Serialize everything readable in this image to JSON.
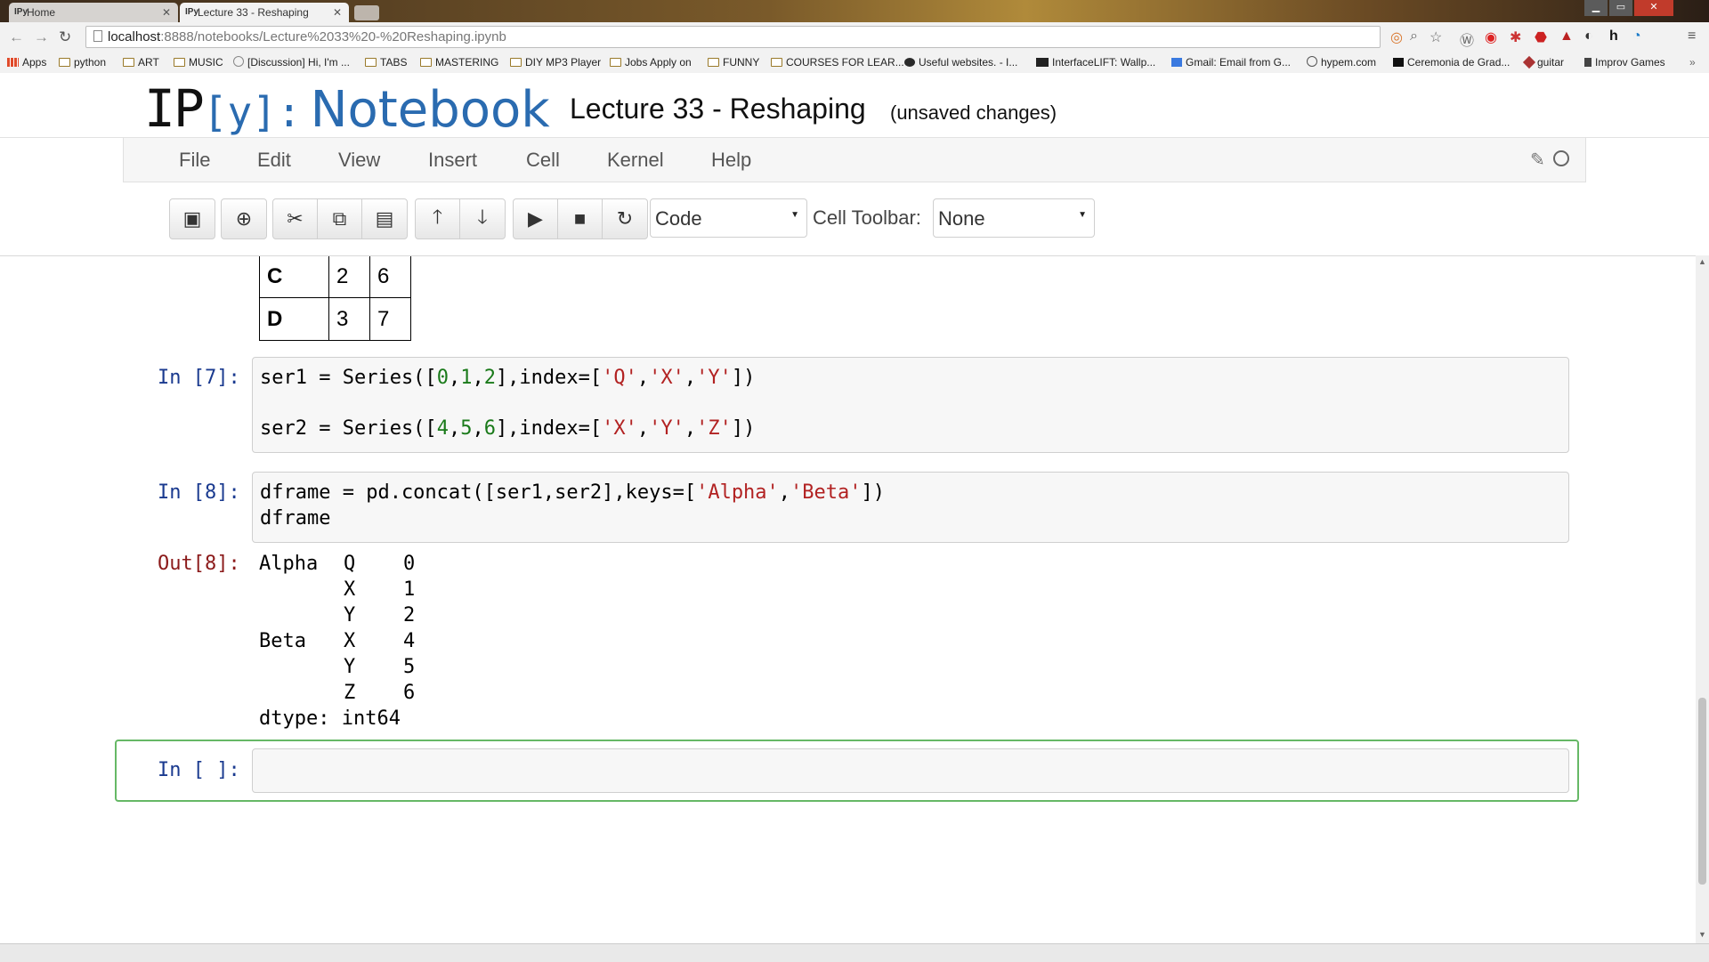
{
  "browser": {
    "tabs": [
      {
        "favicon": "IPy",
        "title": "Home"
      },
      {
        "favicon": "IPy",
        "title": "Lecture 33 - Reshaping"
      }
    ],
    "url_host": "localhost",
    "url_rest": ":8888/notebooks/Lecture%2033%20-%20Reshaping.ipynb",
    "bookmarks": [
      {
        "label": "Apps",
        "icon": "apps-grid-icon"
      },
      {
        "label": "python",
        "icon": "folder-icon"
      },
      {
        "label": "ART",
        "icon": "folder-icon"
      },
      {
        "label": "MUSIC",
        "icon": "folder-icon"
      },
      {
        "label": "[Discussion] Hi, I'm ...",
        "icon": "reddit-icon"
      },
      {
        "label": "TABS",
        "icon": "folder-icon"
      },
      {
        "label": "MASTERING",
        "icon": "folder-icon"
      },
      {
        "label": "DIY MP3 Player",
        "icon": "folder-icon"
      },
      {
        "label": "Jobs Apply on",
        "icon": "folder-icon"
      },
      {
        "label": "FUNNY",
        "icon": "folder-icon"
      },
      {
        "label": "COURSES FOR LEAR...",
        "icon": "folder-icon"
      },
      {
        "label": "Useful websites. - I...",
        "icon": "site-icon"
      },
      {
        "label": "InterfaceLIFT: Wallp...",
        "icon": "ifl-icon"
      },
      {
        "label": "Gmail: Email from G...",
        "icon": "google-icon"
      },
      {
        "label": "hypem.com",
        "icon": "hypem-icon"
      },
      {
        "label": "Ceremonia de Grad...",
        "icon": "site-icon"
      },
      {
        "label": "guitar",
        "icon": "guitar-icon"
      },
      {
        "label": "Improv Games",
        "icon": "site-icon"
      }
    ]
  },
  "notebook": {
    "logo_ip": "IP",
    "logo_y": "[y]",
    "logo_colon": ":",
    "logo_text": "Notebook",
    "title": "Lecture 33 - Reshaping",
    "status": "(unsaved changes)",
    "menu": [
      "File",
      "Edit",
      "View",
      "Insert",
      "Cell",
      "Kernel",
      "Help"
    ],
    "cell_type": "Code",
    "cell_toolbar_label": "Cell Toolbar:",
    "cell_toolbar_value": "None"
  },
  "table_fragment": {
    "rows": [
      {
        "index": "C",
        "values": [
          "2",
          "6"
        ]
      },
      {
        "index": "D",
        "values": [
          "3",
          "7"
        ]
      }
    ]
  },
  "cells": {
    "c7": {
      "prompt": "In [7]:",
      "line1": "ser1 = Series([0,1,2],index=['Q','X','Y'])",
      "line2": "ser2 = Series([4,5,6],index=['X','Y','Z'])"
    },
    "c8": {
      "prompt": "In [8]:",
      "line1": "dframe = pd.concat([ser1,ser2],keys=['Alpha','Beta'])",
      "line2": "dframe",
      "out_prompt": "Out[8]:",
      "output": [
        {
          "key": "Alpha",
          "idx": "Q",
          "val": "0"
        },
        {
          "key": "",
          "idx": "X",
          "val": "1"
        },
        {
          "key": "",
          "idx": "Y",
          "val": "2"
        },
        {
          "key": "Beta",
          "idx": "X",
          "val": "4"
        },
        {
          "key": "",
          "idx": "Y",
          "val": "5"
        },
        {
          "key": "",
          "idx": "Z",
          "val": "6"
        }
      ],
      "dtype": "dtype: int64"
    },
    "empty": {
      "prompt": "In [ ]:",
      "value": ""
    }
  }
}
